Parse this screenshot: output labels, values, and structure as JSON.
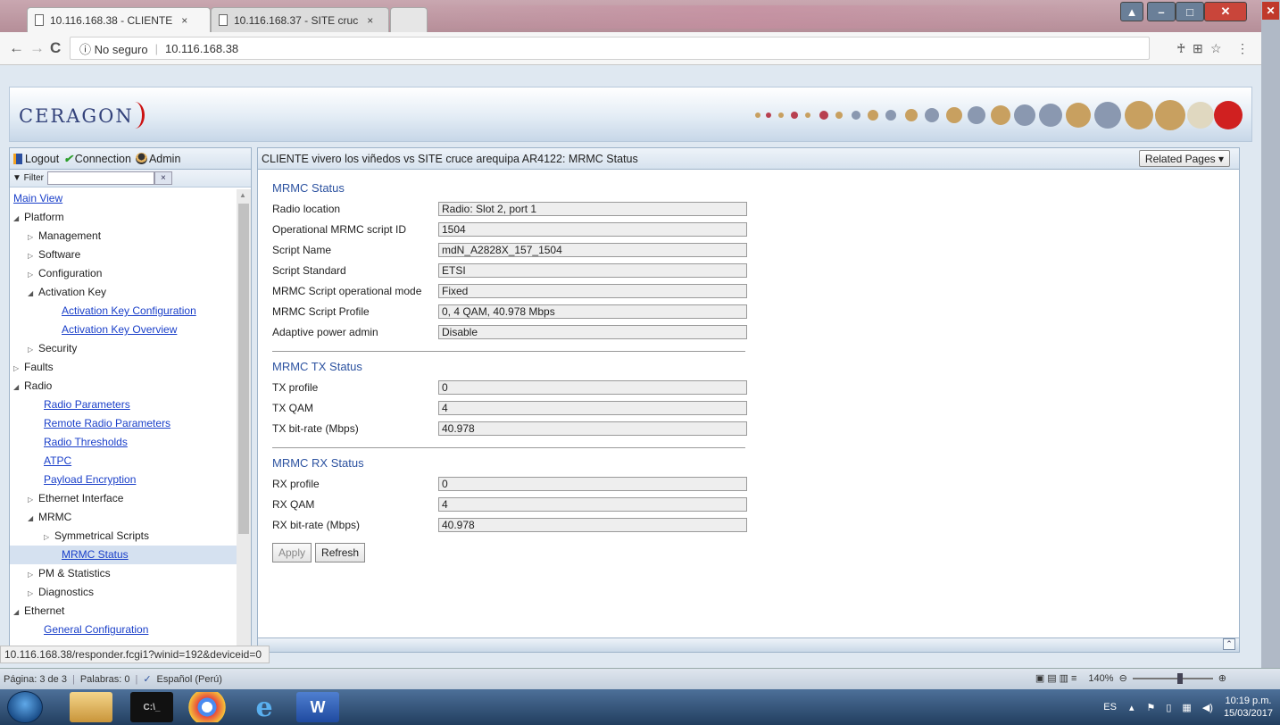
{
  "browser": {
    "tabs": [
      {
        "label": "10.116.168.38 - CLIENTE",
        "close": "×"
      },
      {
        "label": "10.116.168.37 - SITE cruc",
        "close": "×"
      }
    ],
    "back": "←",
    "forward": "→",
    "reload": "C",
    "security": "ⓘ No seguro",
    "url": "10.116.168.38",
    "star": "☆",
    "menu": "⋮",
    "status_url": "10.116.168.38/responder.fcgi1?winid=192&deviceid=0"
  },
  "banner": {
    "logo": "CERAGON"
  },
  "sidebar": {
    "top": {
      "logout": "Logout",
      "connection": "Connection",
      "admin": "Admin"
    },
    "filter_label": "▼ Filter",
    "filter_clear": "×",
    "items": [
      {
        "label": "Main View",
        "level": 0,
        "type": "link"
      },
      {
        "label": "Platform",
        "level": 0,
        "type": "open"
      },
      {
        "label": "Management",
        "level": 1,
        "type": "closed"
      },
      {
        "label": "Software",
        "level": 1,
        "type": "closed"
      },
      {
        "label": "Configuration",
        "level": 1,
        "type": "closed"
      },
      {
        "label": "Activation Key",
        "level": 1,
        "type": "open"
      },
      {
        "label": "Activation Key Configuration",
        "level": 3,
        "type": "link"
      },
      {
        "label": "Activation Key Overview",
        "level": 3,
        "type": "link"
      },
      {
        "label": "Security",
        "level": 1,
        "type": "closed"
      },
      {
        "label": "Faults",
        "level": 0,
        "type": "closed"
      },
      {
        "label": "Radio",
        "level": 0,
        "type": "open"
      },
      {
        "label": "Radio Parameters",
        "level": 2,
        "type": "link"
      },
      {
        "label": "Remote Radio Parameters",
        "level": 2,
        "type": "link"
      },
      {
        "label": "Radio Thresholds",
        "level": 2,
        "type": "link"
      },
      {
        "label": "ATPC",
        "level": 2,
        "type": "link"
      },
      {
        "label": "Payload Encryption",
        "level": 2,
        "type": "link"
      },
      {
        "label": "Ethernet Interface",
        "level": 1,
        "type": "closed"
      },
      {
        "label": "MRMC",
        "level": 1,
        "type": "open"
      },
      {
        "label": "Symmetrical Scripts",
        "level": 2,
        "type": "closed"
      },
      {
        "label": "MRMC Status",
        "level": 3,
        "type": "link",
        "selected": true
      },
      {
        "label": "PM & Statistics",
        "level": 1,
        "type": "closed"
      },
      {
        "label": "Diagnostics",
        "level": 1,
        "type": "closed"
      },
      {
        "label": "Ethernet",
        "level": 0,
        "type": "open"
      },
      {
        "label": "General Configuration",
        "level": 2,
        "type": "link"
      }
    ]
  },
  "main": {
    "title": "CLIENTE vivero los viñedos vs SITE cruce arequipa AR4122: MRMC Status",
    "related_pages": "Related Pages ▾",
    "sections": [
      {
        "title": "MRMC Status",
        "rows": [
          {
            "label": "Radio location",
            "value": "Radio: Slot 2, port 1"
          },
          {
            "label": "Operational MRMC script ID",
            "value": "1504"
          },
          {
            "label": "Script Name",
            "value": "mdN_A2828X_157_1504"
          },
          {
            "label": "Script Standard",
            "value": "ETSI"
          },
          {
            "label": "MRMC Script operational mode",
            "value": "Fixed"
          },
          {
            "label": "MRMC Script Profile",
            "value": "0, 4 QAM, 40.978 Mbps"
          },
          {
            "label": "Adaptive power admin",
            "value": "Disable"
          }
        ]
      },
      {
        "title": "MRMC TX Status",
        "rows": [
          {
            "label": "TX profile",
            "value": "0"
          },
          {
            "label": "TX QAM",
            "value": "4"
          },
          {
            "label": "TX bit-rate (Mbps)",
            "value": "40.978"
          }
        ]
      },
      {
        "title": "MRMC RX Status",
        "rows": [
          {
            "label": "RX profile",
            "value": "0"
          },
          {
            "label": "RX QAM",
            "value": "4"
          },
          {
            "label": "RX bit-rate (Mbps)",
            "value": "40.978"
          }
        ]
      }
    ],
    "apply": "Apply",
    "refresh": "Refresh"
  },
  "word_status": {
    "page": "Página: 3 de 3",
    "words": "Palabras: 0",
    "language": "Español (Perú)",
    "zoom": "140%"
  },
  "taskbar": {
    "lang": "ES",
    "time": "10:19 p.m.",
    "date": "15/03/2017"
  },
  "colors": {
    "accent": "#2c52a0",
    "link": "#1a3fc9",
    "logo": "#33427a"
  }
}
